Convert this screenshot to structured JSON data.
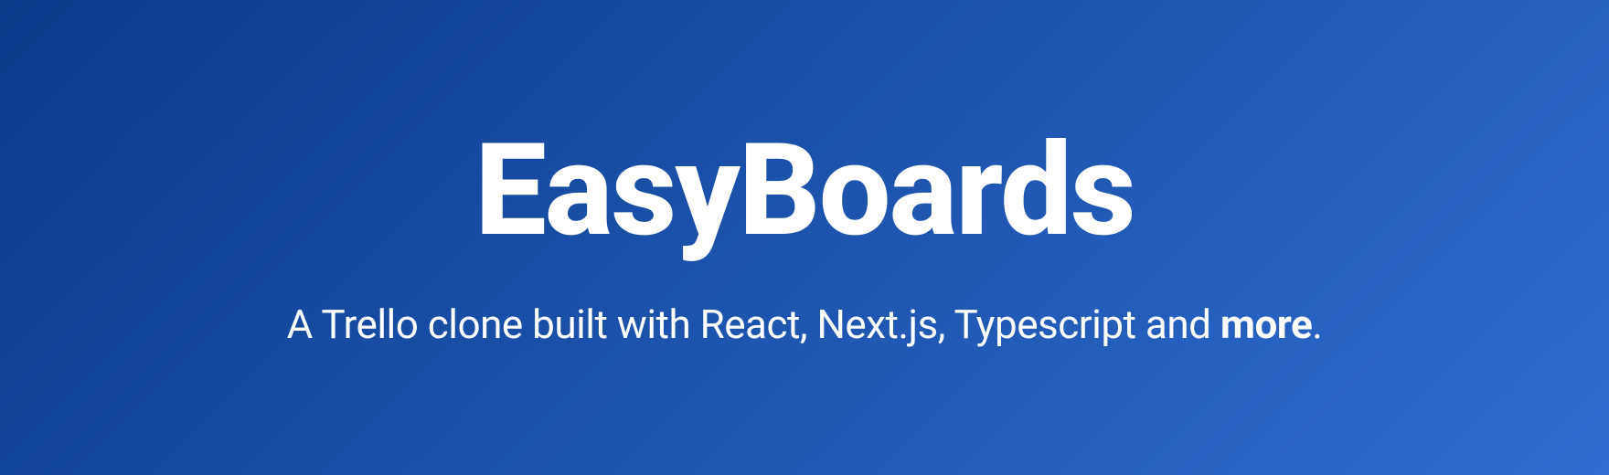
{
  "hero": {
    "title": "EasyBoards",
    "subtitle_prefix": "A Trello clone built with React, Next.js, Typescript and ",
    "subtitle_bold": "more",
    "subtitle_suffix": "."
  }
}
